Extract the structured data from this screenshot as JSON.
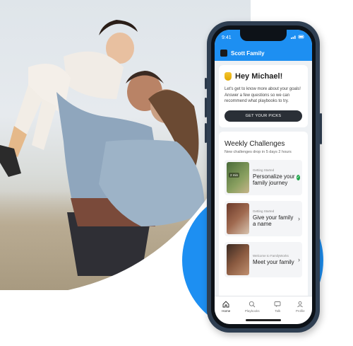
{
  "status": {
    "time": "9:41"
  },
  "appbar": {
    "title": "Scott Family"
  },
  "greeting": {
    "title": "Hey Michael!",
    "body": "Let's get to know more about your goals! Answer a few questions so we can recommend what playbooks to try.",
    "cta": "GET YOUR PICKS"
  },
  "challenges": {
    "title": "Weekly Challenges",
    "subtitle": "New challenges drop in 5 days 2 hours",
    "items": [
      {
        "category": "Getting Started",
        "name": "Personalize your family journey",
        "badge": "2 min",
        "done": true
      },
      {
        "category": "Getting Started",
        "name": "Give your family a name",
        "badge": "",
        "done": false
      },
      {
        "category": "Welcome to FamilyWorks",
        "name": "Meet your family",
        "badge": "",
        "done": false
      }
    ]
  },
  "tabs": [
    {
      "label": "Home",
      "icon": "home-icon",
      "active": true
    },
    {
      "label": "Playbooks",
      "icon": "search-icon",
      "active": false
    },
    {
      "label": "Talk",
      "icon": "chat-icon",
      "active": false
    },
    {
      "label": "Profile",
      "icon": "profile-icon",
      "active": false
    }
  ],
  "colors": {
    "accent": "#1d8ff2",
    "dark": "#2a2f36",
    "success": "#1fa64a"
  }
}
